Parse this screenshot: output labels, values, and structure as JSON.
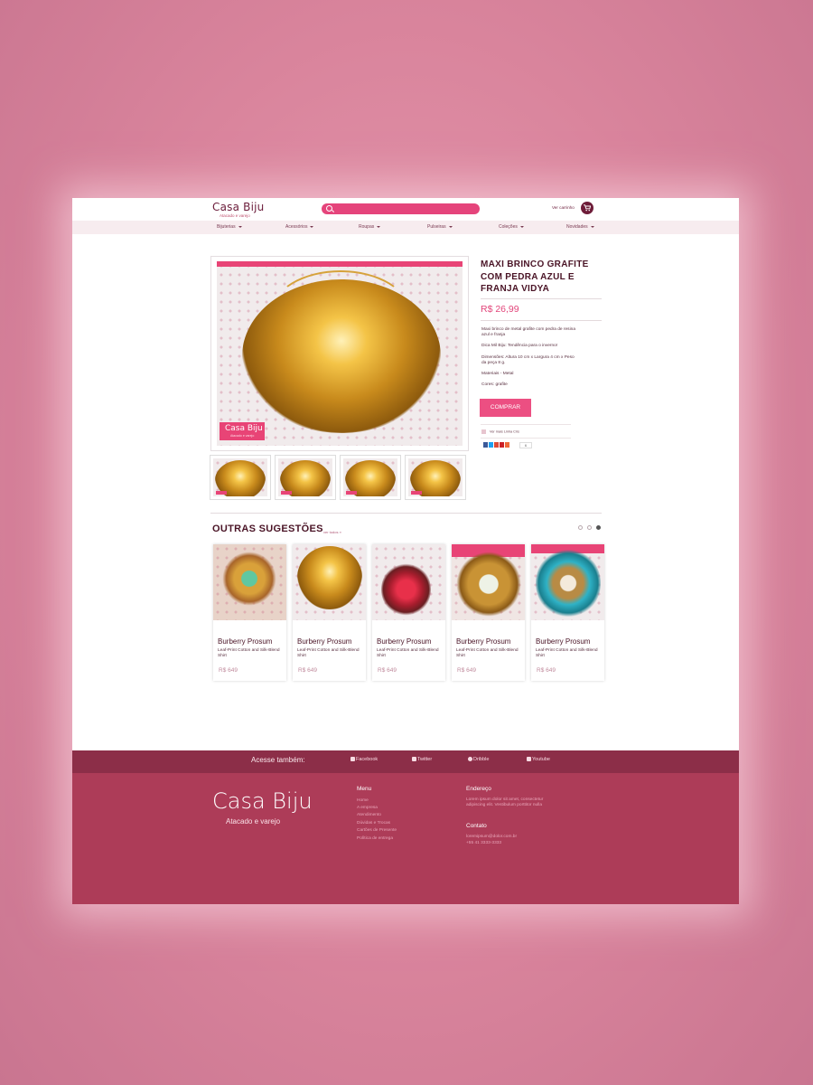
{
  "header": {
    "logo": "Casa Biju",
    "logo_sub": "Atacado e varejo",
    "cart_label": "Ver carrinho"
  },
  "nav": [
    "Bijuterias",
    "Acessórios",
    "Roupas",
    "Pulseiras",
    "Coleções",
    "Novidades"
  ],
  "product": {
    "title": "MAXI BRINCO GRAFITE COM PEDRA AZUL E FRANJA VIDYA",
    "price": "R$ 26,99",
    "desc1": "Maxi brinco de metal grafite com pedra de resina azul e franja",
    "desc2": "Dica Mil Biju: Tendência para o inverno!",
    "desc3": "Dimensões: Altura 10 cm x Largura 4 cm x Peso da peça 8 g.",
    "desc4": "Materiais - Metal",
    "desc5": "Cores: grafite",
    "buy_label": "COMPRAR",
    "see_more": "Ver mais Linha Cris",
    "share_count": "6",
    "image_stamp": "Casa Biju",
    "image_stamp_sub": "Atacado e varejo"
  },
  "suggestions": {
    "title": "OUTRAS SUGESTÕES",
    "link": "ver todos »",
    "cards": [
      {
        "name": "Burberry Prosum",
        "desc": "Leaf-Print Cotton and Silk-Blend Shirt",
        "price": "R$ 649"
      },
      {
        "name": "Burberry Prosum",
        "desc": "Leaf-Print Cotton and Silk-Blend Shirt",
        "price": "R$ 649"
      },
      {
        "name": "Burberry Prosum",
        "desc": "Leaf-Print Cotton and Silk-Blend Shirt",
        "price": "R$ 649"
      },
      {
        "name": "Burberry Prosum",
        "desc": "Leaf-Print Cotton and Silk-Blend Shirt",
        "price": "R$ 649"
      },
      {
        "name": "Burberry Prosum",
        "desc": "Leaf-Print Cotton and Silk-Blend Shirt",
        "price": "R$ 649"
      }
    ]
  },
  "footer": {
    "access_label": "Acesse também:",
    "social": [
      "Facebook",
      "Twitter",
      "Dribble",
      "Youtube"
    ],
    "logo": "Casa Biju",
    "logo_sub": "Atacado e varejo",
    "menu_title": "Menu",
    "menu": [
      "Home",
      "A empresa",
      "Atendimento",
      "Dúvidas e Trocas",
      "Cartões de Presente",
      "Política de entrega"
    ],
    "address_title": "Endereço",
    "address": "Lorem ipsum dolor sit amet, consectetur adipiscing elit. Vestibulum porttitor nulla",
    "contact_title": "Contato",
    "email": "loremipsum@dolor.com.br",
    "phone": "+55 41 3333-3333"
  },
  "colors": {
    "accent": "#e84476",
    "wine": "#6e1d39",
    "footer_bar": "#8c2e48",
    "footer_main": "#ad3c58"
  }
}
